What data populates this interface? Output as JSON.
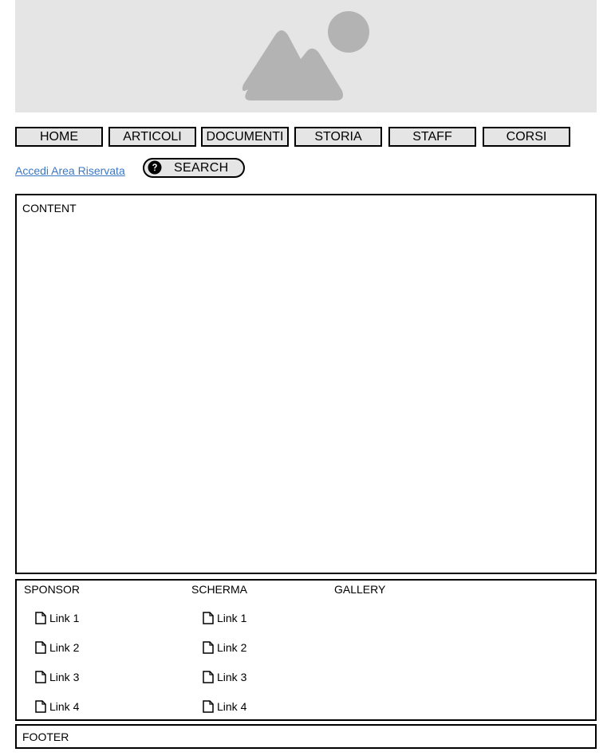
{
  "hero": {
    "icon": "image-placeholder-icon"
  },
  "nav": {
    "items": [
      {
        "label": "HOME"
      },
      {
        "label": "ARTICOLI"
      },
      {
        "label": "DOCUMENTI"
      },
      {
        "label": "STORIA"
      },
      {
        "label": "STAFF"
      },
      {
        "label": "CORSI"
      }
    ]
  },
  "login_link": "Accedi Area Riservata",
  "search": {
    "label": "SEARCH",
    "icon": "help-circle-icon"
  },
  "content": {
    "title": "CONTENT"
  },
  "links_section": {
    "columns": [
      {
        "title": "SPONSOR",
        "links": [
          "Link 1",
          "Link 2",
          "Link 3",
          "Link 4"
        ]
      },
      {
        "title": "SCHERMA",
        "links": [
          "Link 1",
          "Link 2",
          "Link 3",
          "Link 4"
        ]
      },
      {
        "title": "GALLERY",
        "links": []
      }
    ],
    "link_icon": "document-icon"
  },
  "footer": {
    "title": "FOOTER"
  },
  "colors": {
    "placeholder_bg": "#e5e5e5",
    "placeholder_shape": "#b3b3b3",
    "link": "#3a78c4",
    "border": "#000000"
  }
}
